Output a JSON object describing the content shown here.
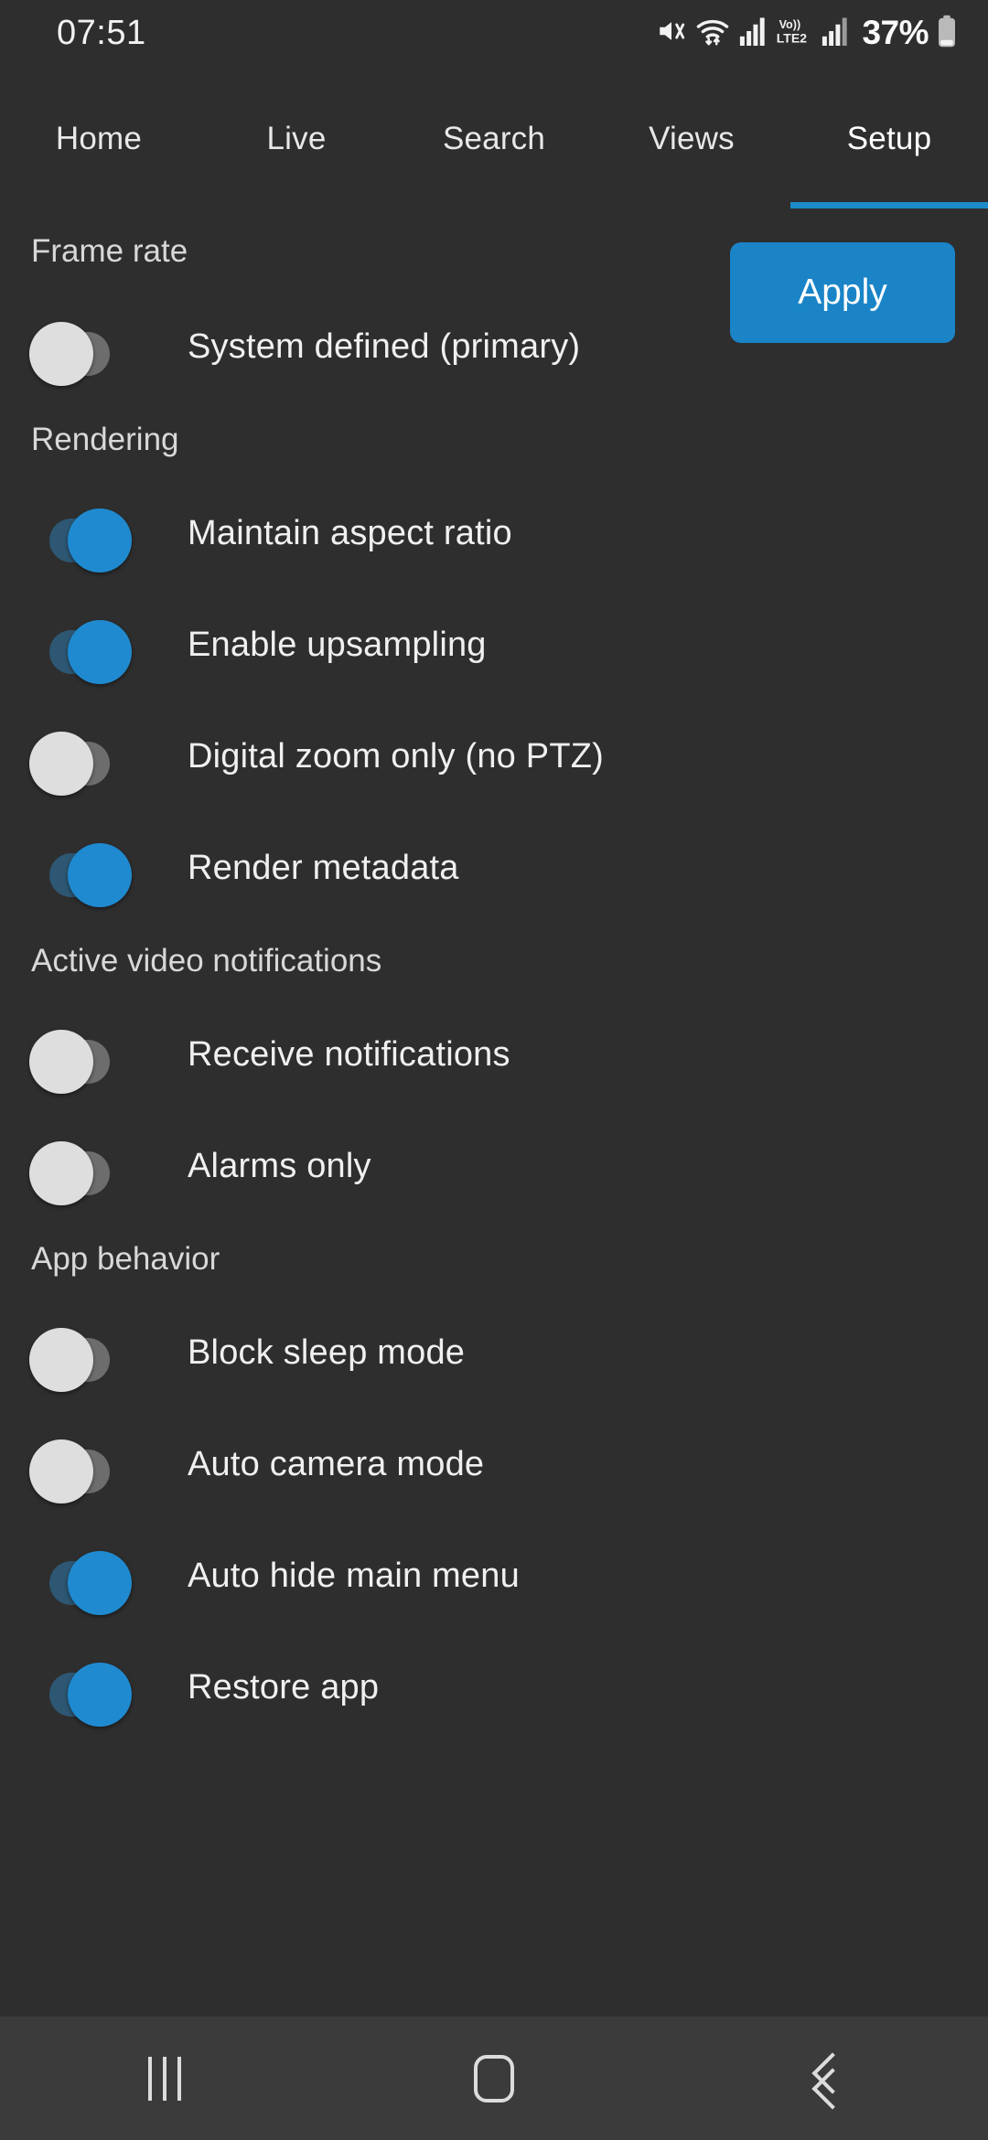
{
  "status_bar": {
    "time": "07:51",
    "battery_percent": "37%",
    "icons": [
      "mute-icon",
      "wifi-icon",
      "signal-bars-icon",
      "volte2-icon",
      "signal-bars-2-icon",
      "battery-icon"
    ],
    "volte_label": "VoLTE2"
  },
  "tabs": [
    {
      "label": "Home",
      "active": false
    },
    {
      "label": "Live",
      "active": false
    },
    {
      "label": "Search",
      "active": false
    },
    {
      "label": "Views",
      "active": false
    },
    {
      "label": "Setup",
      "active": true
    }
  ],
  "toolbar": {
    "apply_label": "Apply"
  },
  "colors": {
    "background": "#2e2e2e",
    "accent": "#1a84c7",
    "toggle_on_thumb": "#1f8ad0",
    "toggle_on_track": "#2d5773",
    "toggle_off_thumb": "#dedede",
    "toggle_off_track": "#6d6d6d",
    "navbar": "#3b3b3b"
  },
  "sections": [
    {
      "title": "Frame rate",
      "rows": [
        {
          "label": "System defined (primary)",
          "on": false
        }
      ]
    },
    {
      "title": "Rendering",
      "rows": [
        {
          "label": "Maintain aspect ratio",
          "on": true
        },
        {
          "label": "Enable upsampling",
          "on": true
        },
        {
          "label": "Digital zoom only (no PTZ)",
          "on": false
        },
        {
          "label": "Render metadata",
          "on": true
        }
      ]
    },
    {
      "title": "Active video notifications",
      "rows": [
        {
          "label": "Receive notifications",
          "on": false
        },
        {
          "label": "Alarms only",
          "on": false
        }
      ]
    },
    {
      "title": "App behavior",
      "rows": [
        {
          "label": "Block sleep mode",
          "on": false
        },
        {
          "label": "Auto camera mode",
          "on": false
        },
        {
          "label": "Auto hide main menu",
          "on": true
        },
        {
          "label": "Restore app",
          "on": true
        }
      ]
    }
  ],
  "navbar": {
    "buttons": [
      {
        "name": "recents-button",
        "icon": "recents-icon"
      },
      {
        "name": "home-button",
        "icon": "home-icon"
      },
      {
        "name": "back-button",
        "icon": "back-chevron-icon"
      }
    ]
  }
}
